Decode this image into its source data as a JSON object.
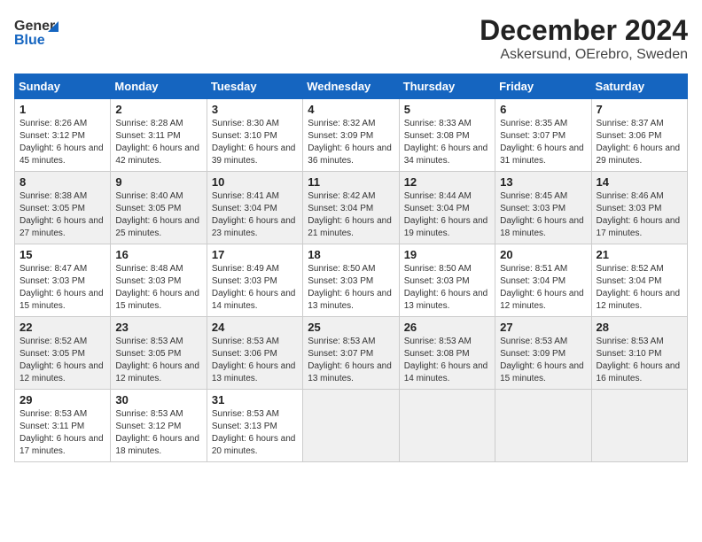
{
  "header": {
    "logo_line1": "General",
    "logo_line2": "Blue",
    "month": "December 2024",
    "location": "Askersund, OErebro, Sweden"
  },
  "days_of_week": [
    "Sunday",
    "Monday",
    "Tuesday",
    "Wednesday",
    "Thursday",
    "Friday",
    "Saturday"
  ],
  "weeks": [
    [
      {
        "day": "1",
        "sunrise": "Sunrise: 8:26 AM",
        "sunset": "Sunset: 3:12 PM",
        "daylight": "Daylight: 6 hours and 45 minutes."
      },
      {
        "day": "2",
        "sunrise": "Sunrise: 8:28 AM",
        "sunset": "Sunset: 3:11 PM",
        "daylight": "Daylight: 6 hours and 42 minutes."
      },
      {
        "day": "3",
        "sunrise": "Sunrise: 8:30 AM",
        "sunset": "Sunset: 3:10 PM",
        "daylight": "Daylight: 6 hours and 39 minutes."
      },
      {
        "day": "4",
        "sunrise": "Sunrise: 8:32 AM",
        "sunset": "Sunset: 3:09 PM",
        "daylight": "Daylight: 6 hours and 36 minutes."
      },
      {
        "day": "5",
        "sunrise": "Sunrise: 8:33 AM",
        "sunset": "Sunset: 3:08 PM",
        "daylight": "Daylight: 6 hours and 34 minutes."
      },
      {
        "day": "6",
        "sunrise": "Sunrise: 8:35 AM",
        "sunset": "Sunset: 3:07 PM",
        "daylight": "Daylight: 6 hours and 31 minutes."
      },
      {
        "day": "7",
        "sunrise": "Sunrise: 8:37 AM",
        "sunset": "Sunset: 3:06 PM",
        "daylight": "Daylight: 6 hours and 29 minutes."
      }
    ],
    [
      {
        "day": "8",
        "sunrise": "Sunrise: 8:38 AM",
        "sunset": "Sunset: 3:05 PM",
        "daylight": "Daylight: 6 hours and 27 minutes."
      },
      {
        "day": "9",
        "sunrise": "Sunrise: 8:40 AM",
        "sunset": "Sunset: 3:05 PM",
        "daylight": "Daylight: 6 hours and 25 minutes."
      },
      {
        "day": "10",
        "sunrise": "Sunrise: 8:41 AM",
        "sunset": "Sunset: 3:04 PM",
        "daylight": "Daylight: 6 hours and 23 minutes."
      },
      {
        "day": "11",
        "sunrise": "Sunrise: 8:42 AM",
        "sunset": "Sunset: 3:04 PM",
        "daylight": "Daylight: 6 hours and 21 minutes."
      },
      {
        "day": "12",
        "sunrise": "Sunrise: 8:44 AM",
        "sunset": "Sunset: 3:04 PM",
        "daylight": "Daylight: 6 hours and 19 minutes."
      },
      {
        "day": "13",
        "sunrise": "Sunrise: 8:45 AM",
        "sunset": "Sunset: 3:03 PM",
        "daylight": "Daylight: 6 hours and 18 minutes."
      },
      {
        "day": "14",
        "sunrise": "Sunrise: 8:46 AM",
        "sunset": "Sunset: 3:03 PM",
        "daylight": "Daylight: 6 hours and 17 minutes."
      }
    ],
    [
      {
        "day": "15",
        "sunrise": "Sunrise: 8:47 AM",
        "sunset": "Sunset: 3:03 PM",
        "daylight": "Daylight: 6 hours and 15 minutes."
      },
      {
        "day": "16",
        "sunrise": "Sunrise: 8:48 AM",
        "sunset": "Sunset: 3:03 PM",
        "daylight": "Daylight: 6 hours and 15 minutes."
      },
      {
        "day": "17",
        "sunrise": "Sunrise: 8:49 AM",
        "sunset": "Sunset: 3:03 PM",
        "daylight": "Daylight: 6 hours and 14 minutes."
      },
      {
        "day": "18",
        "sunrise": "Sunrise: 8:50 AM",
        "sunset": "Sunset: 3:03 PM",
        "daylight": "Daylight: 6 hours and 13 minutes."
      },
      {
        "day": "19",
        "sunrise": "Sunrise: 8:50 AM",
        "sunset": "Sunset: 3:03 PM",
        "daylight": "Daylight: 6 hours and 13 minutes."
      },
      {
        "day": "20",
        "sunrise": "Sunrise: 8:51 AM",
        "sunset": "Sunset: 3:04 PM",
        "daylight": "Daylight: 6 hours and 12 minutes."
      },
      {
        "day": "21",
        "sunrise": "Sunrise: 8:52 AM",
        "sunset": "Sunset: 3:04 PM",
        "daylight": "Daylight: 6 hours and 12 minutes."
      }
    ],
    [
      {
        "day": "22",
        "sunrise": "Sunrise: 8:52 AM",
        "sunset": "Sunset: 3:05 PM",
        "daylight": "Daylight: 6 hours and 12 minutes."
      },
      {
        "day": "23",
        "sunrise": "Sunrise: 8:53 AM",
        "sunset": "Sunset: 3:05 PM",
        "daylight": "Daylight: 6 hours and 12 minutes."
      },
      {
        "day": "24",
        "sunrise": "Sunrise: 8:53 AM",
        "sunset": "Sunset: 3:06 PM",
        "daylight": "Daylight: 6 hours and 13 minutes."
      },
      {
        "day": "25",
        "sunrise": "Sunrise: 8:53 AM",
        "sunset": "Sunset: 3:07 PM",
        "daylight": "Daylight: 6 hours and 13 minutes."
      },
      {
        "day": "26",
        "sunrise": "Sunrise: 8:53 AM",
        "sunset": "Sunset: 3:08 PM",
        "daylight": "Daylight: 6 hours and 14 minutes."
      },
      {
        "day": "27",
        "sunrise": "Sunrise: 8:53 AM",
        "sunset": "Sunset: 3:09 PM",
        "daylight": "Daylight: 6 hours and 15 minutes."
      },
      {
        "day": "28",
        "sunrise": "Sunrise: 8:53 AM",
        "sunset": "Sunset: 3:10 PM",
        "daylight": "Daylight: 6 hours and 16 minutes."
      }
    ],
    [
      {
        "day": "29",
        "sunrise": "Sunrise: 8:53 AM",
        "sunset": "Sunset: 3:11 PM",
        "daylight": "Daylight: 6 hours and 17 minutes."
      },
      {
        "day": "30",
        "sunrise": "Sunrise: 8:53 AM",
        "sunset": "Sunset: 3:12 PM",
        "daylight": "Daylight: 6 hours and 18 minutes."
      },
      {
        "day": "31",
        "sunrise": "Sunrise: 8:53 AM",
        "sunset": "Sunset: 3:13 PM",
        "daylight": "Daylight: 6 hours and 20 minutes."
      },
      null,
      null,
      null,
      null
    ]
  ]
}
